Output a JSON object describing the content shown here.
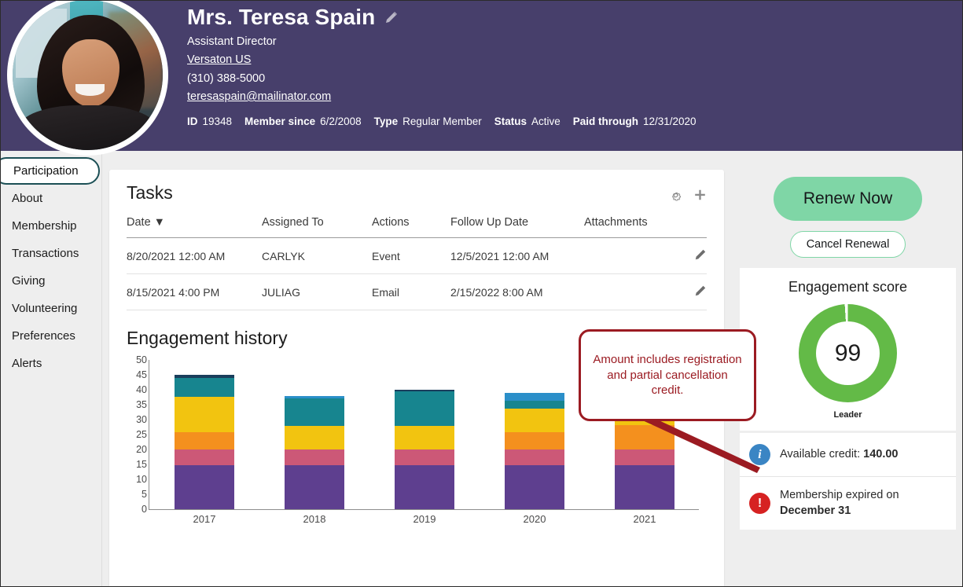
{
  "header": {
    "name": "Mrs. Teresa Spain",
    "edit_icon": "pencil-icon",
    "title": "Assistant Director",
    "organization": "Versaton US",
    "phone": "(310) 388-5000",
    "email": "teresaspain@mailinator.com",
    "meta": [
      {
        "label": "ID",
        "value": "19348"
      },
      {
        "label": "Member since",
        "value": "6/2/2008"
      },
      {
        "label": "Type",
        "value": "Regular Member"
      },
      {
        "label": "Status",
        "value": "Active"
      },
      {
        "label": "Paid through",
        "value": "12/31/2020"
      }
    ],
    "bg_color": "#473f6b"
  },
  "sidebar": {
    "items": [
      {
        "label": "Participation",
        "active": true
      },
      {
        "label": "About",
        "active": false
      },
      {
        "label": "Membership",
        "active": false
      },
      {
        "label": "Transactions",
        "active": false
      },
      {
        "label": "Giving",
        "active": false
      },
      {
        "label": "Volunteering",
        "active": false
      },
      {
        "label": "Preferences",
        "active": false
      },
      {
        "label": "Alerts",
        "active": false
      }
    ]
  },
  "tasks": {
    "title": "Tasks",
    "settings_icon": "gear-icon",
    "add_icon": "plus-icon",
    "columns": [
      "Date ▼",
      "Assigned To",
      "Actions",
      "Follow Up Date",
      "Attachments"
    ],
    "rows": [
      {
        "date": "8/20/2021 12:00 AM",
        "assigned_to": "CARLYK",
        "action": "Event",
        "follow_up": "12/5/2021 12:00 AM",
        "attachments": "",
        "edit_icon": "pencil-icon"
      },
      {
        "date": "8/15/2021 4:00 PM",
        "assigned_to": "JULIAG",
        "action": "Email",
        "follow_up": "2/15/2022 8:00 AM",
        "attachments": "",
        "edit_icon": "pencil-icon"
      }
    ]
  },
  "chart_data": {
    "type": "bar",
    "title": "Engagement history",
    "stacked": true,
    "xlabel": "",
    "ylabel": "",
    "ylim": [
      0,
      50
    ],
    "yticks": [
      0,
      5,
      10,
      15,
      20,
      25,
      30,
      35,
      40,
      45,
      50
    ],
    "grid": false,
    "legend": "none",
    "categories": [
      "2017",
      "2018",
      "2019",
      "2020",
      "2021"
    ],
    "series": [
      {
        "name": "purple",
        "color": "#5e3f8f",
        "values": [
          14.8,
          14.8,
          14.8,
          14.8,
          14.8
        ]
      },
      {
        "name": "pink",
        "color": "#cc5877",
        "values": [
          5.2,
          5.2,
          5.2,
          5.2,
          5.2
        ]
      },
      {
        "name": "orange",
        "color": "#f4901e",
        "values": [
          5.7,
          0,
          0,
          5.7,
          8.2
        ]
      },
      {
        "name": "yellow",
        "color": "#f2c410",
        "values": [
          11.9,
          7.8,
          7.8,
          8.0,
          10.2
        ]
      },
      {
        "name": "teal",
        "color": "#17858f",
        "values": [
          6.4,
          9.2,
          11.7,
          2.7,
          5.1
        ]
      },
      {
        "name": "navy",
        "color": "#1a3e5c",
        "values": [
          1.0,
          0,
          0.5,
          0,
          0
        ]
      },
      {
        "name": "light-blue",
        "color": "#2b8fc9",
        "values": [
          0,
          1.0,
          0,
          2.6,
          2.5
        ]
      }
    ],
    "totals": [
      45,
      38,
      40,
      39,
      46
    ]
  },
  "right_panel": {
    "renew_label": "Renew Now",
    "cancel_label": "Cancel Renewal",
    "renew_color": "#7fd6a6",
    "engagement": {
      "title": "Engagement score",
      "score": "99",
      "level": "Leader",
      "ring_color": "#63ba47",
      "percent": 99
    },
    "alerts": [
      {
        "icon": "info-icon",
        "icon_glyph": "i",
        "icon_color": "#3a85c4",
        "text_prefix": "Available credit: ",
        "text_strong": "140.00",
        "text_suffix": ""
      },
      {
        "icon": "alert-icon",
        "icon_glyph": "!",
        "icon_color": "#d62222",
        "text_prefix": "Membership expired on ",
        "text_strong": "December 31",
        "text_suffix": ""
      }
    ]
  },
  "callout": {
    "text": "Amount includes registration and partial cancellation credit.",
    "color": "#9b1b22"
  }
}
